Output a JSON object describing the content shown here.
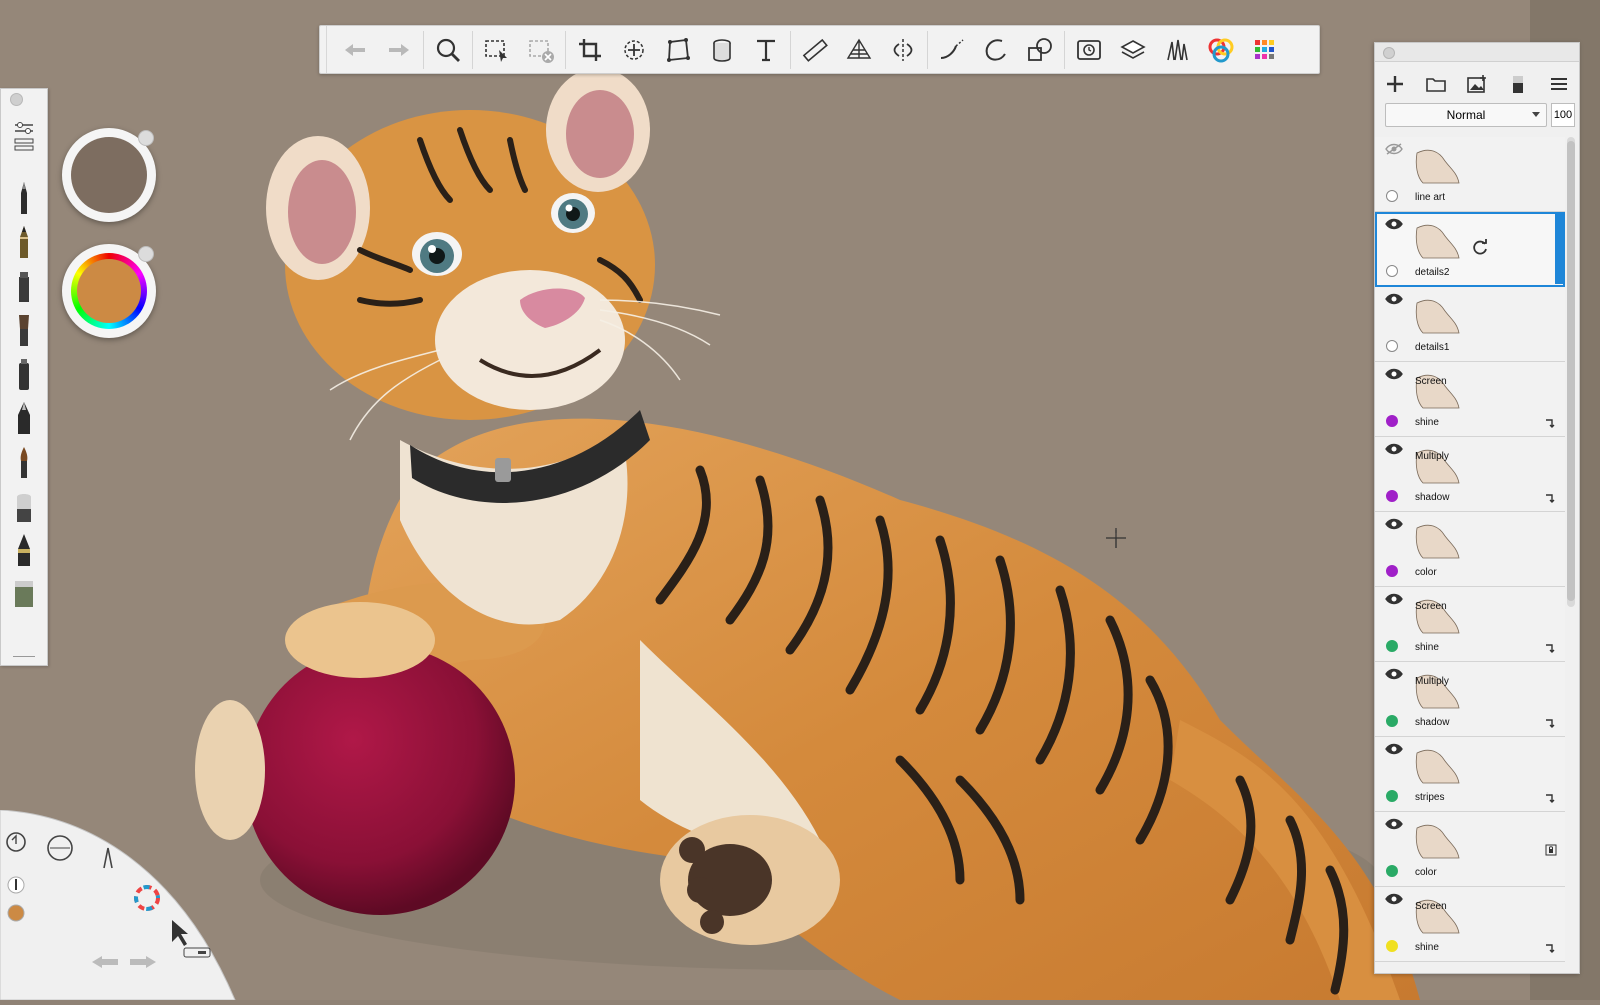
{
  "app": {
    "toolbar": {
      "tools": [
        "undo-icon",
        "redo-icon",
        "zoom-icon",
        "select-icon",
        "clear-selection-icon",
        "crop-icon",
        "transform-icon",
        "distort-icon",
        "fill-icon",
        "text-icon",
        "ruler-icon",
        "perspective-icon",
        "symmetry-icon",
        "stroke-icon",
        "ellipse-icon",
        "shapes-icon",
        "time-lapse-icon",
        "layers-icon",
        "brush-library-icon",
        "color-editor-icon",
        "swatches-icon"
      ]
    },
    "brushes": [
      "settings-icon",
      "ballpoint-pen-icon",
      "pencil-icon",
      "marker-icon",
      "paint-brush-icon",
      "airbrush-icon",
      "fountain-pen-icon",
      "paintbrush-icon",
      "eraser-icon",
      "ink-pen-icon",
      "texture-brush-icon"
    ],
    "pucks": {
      "brush_color": "#7d6d60",
      "paint_color": "#cc8a44"
    },
    "layers_panel": {
      "blend_mode": "Normal",
      "opacity": "100",
      "layers": [
        {
          "name": "line art",
          "mode": "",
          "visible": false,
          "swatch": "#ffffff",
          "clipped": false,
          "locked": false,
          "selected": false
        },
        {
          "name": "details2",
          "mode": "",
          "visible": true,
          "swatch": "#ffffff",
          "clipped": false,
          "locked": false,
          "selected": true
        },
        {
          "name": "details1",
          "mode": "",
          "visible": true,
          "swatch": "#ffffff",
          "clipped": false,
          "locked": false,
          "selected": false
        },
        {
          "name": "shine",
          "mode": "Screen",
          "visible": true,
          "swatch": "#a020c8",
          "clipped": true,
          "locked": false,
          "selected": false
        },
        {
          "name": "shadow",
          "mode": "Multiply",
          "visible": true,
          "swatch": "#a020c8",
          "clipped": true,
          "locked": false,
          "selected": false
        },
        {
          "name": "color",
          "mode": "",
          "visible": true,
          "swatch": "#a020c8",
          "clipped": false,
          "locked": false,
          "selected": false
        },
        {
          "name": "shine",
          "mode": "Screen",
          "visible": true,
          "swatch": "#2aaa66",
          "clipped": true,
          "locked": false,
          "selected": false
        },
        {
          "name": "shadow",
          "mode": "Multiply",
          "visible": true,
          "swatch": "#2aaa66",
          "clipped": true,
          "locked": false,
          "selected": false
        },
        {
          "name": "stripes",
          "mode": "",
          "visible": true,
          "swatch": "#2aaa66",
          "clipped": true,
          "locked": false,
          "selected": false
        },
        {
          "name": "color",
          "mode": "",
          "visible": true,
          "swatch": "#2aaa66",
          "clipped": false,
          "locked": true,
          "selected": false
        },
        {
          "name": "shine",
          "mode": "Screen",
          "visible": true,
          "swatch": "#f0e020",
          "clipped": true,
          "locked": false,
          "selected": false
        }
      ]
    }
  }
}
